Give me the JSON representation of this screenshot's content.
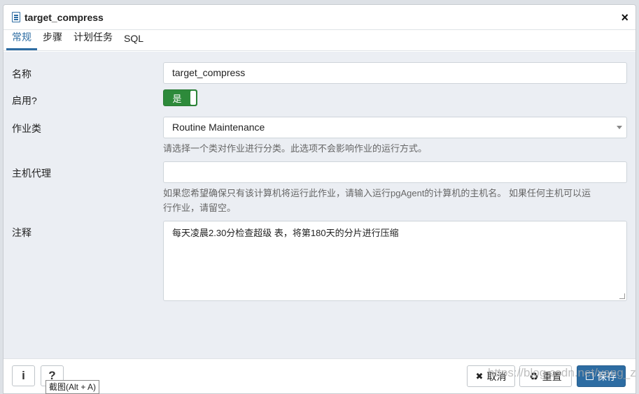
{
  "dialog": {
    "title": "target_compress",
    "close_glyph": "×"
  },
  "tabs": [
    {
      "label": "常规",
      "active": true
    },
    {
      "label": "步骤",
      "active": false
    },
    {
      "label": "计划任务",
      "active": false
    },
    {
      "label": "SQL",
      "active": false
    }
  ],
  "form": {
    "name": {
      "label": "名称",
      "value": "target_compress"
    },
    "enabled": {
      "label": "启用?",
      "value": "是"
    },
    "job_class": {
      "label": "作业类",
      "value": "Routine Maintenance",
      "help": "请选择一个类对作业进行分类。此选项不会影响作业的运行方式。"
    },
    "host_agent": {
      "label": "主机代理",
      "value": "",
      "help_line1": "如果您希望确保只有该计算机将运行此作业，请输入运行pgAgent的计算机的主机名。 如果任何主机可以运",
      "help_line2": "行作业，请留空。"
    },
    "comment": {
      "label": "注释",
      "value": "每天凌晨2.30分检查超级 表，将第180天的分片进行压缩"
    }
  },
  "footer": {
    "info_glyph": "i",
    "help_glyph": "?",
    "cancel_label": "取消",
    "reset_label": "重置",
    "save_label": "保存"
  },
  "tooltip": "截图(Alt + A)",
  "watermark": "https://blog.csdn.net/yang_z",
  "colors": {
    "accent": "#2d6ca2",
    "toggle_on": "#2d8a3a",
    "background": "#ebeef3"
  }
}
